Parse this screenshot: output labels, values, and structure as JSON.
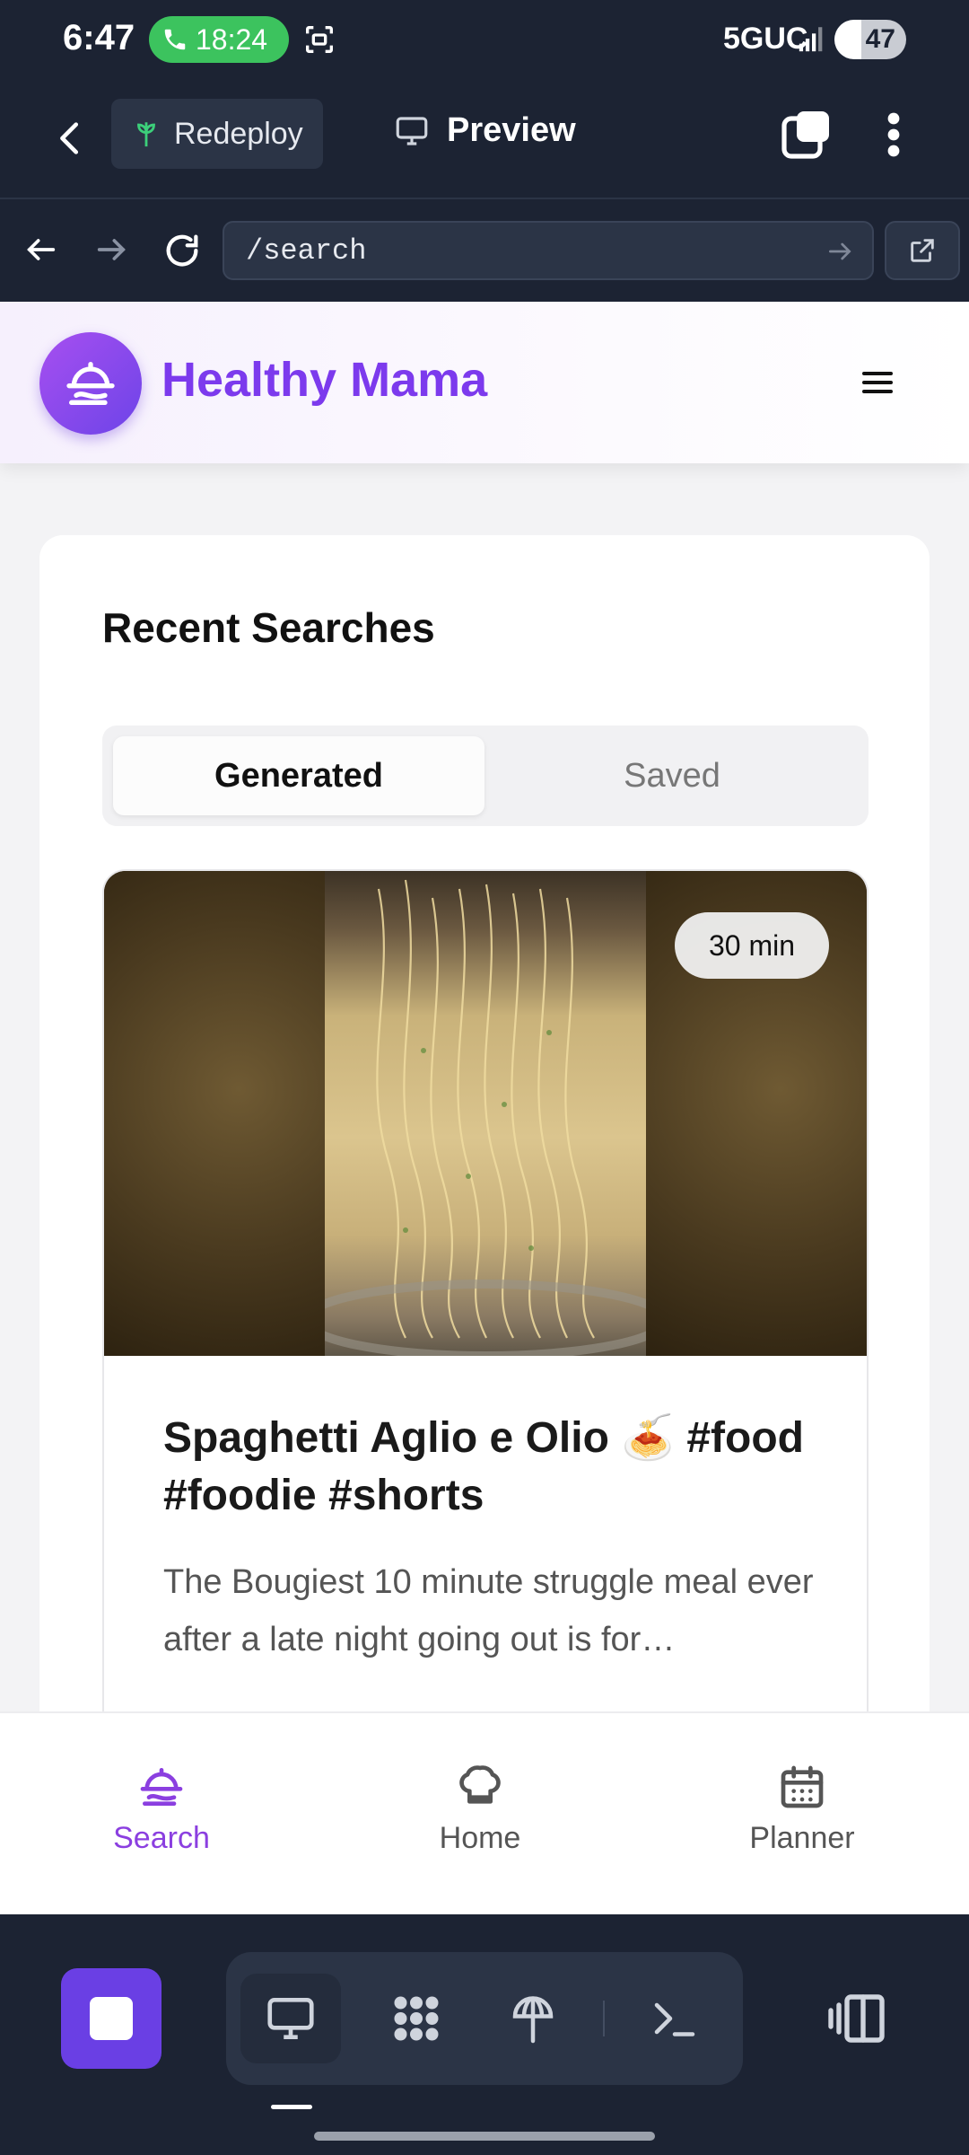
{
  "status_bar": {
    "time": "6:47",
    "call_duration": "18:24",
    "network": "5GUC",
    "battery": "47",
    "battery_level": 0.47
  },
  "toolbar": {
    "redeploy_label": "Redeploy",
    "preview_label": "Preview"
  },
  "url_bar": {
    "path": "/search"
  },
  "site": {
    "brand": "Healthy Mama",
    "brand_color": "#7c3aed",
    "section_title": "Recent Searches",
    "segments": [
      "Generated",
      "Saved"
    ],
    "selected_segment": "Generated",
    "recipe": {
      "time_badge": "30 min",
      "title": "Spaghetti Aglio e Olio 🍝 #food #foodie #shorts",
      "description": "The Bougiest 10 minute struggle meal ever after a late night going out is for…"
    }
  },
  "bottom_nav": {
    "items": [
      {
        "label": "Search",
        "icon": "cloche-icon",
        "active": true
      },
      {
        "label": "Home",
        "icon": "chef-hat-icon",
        "active": false
      },
      {
        "label": "Planner",
        "icon": "calendar-icon",
        "active": false
      }
    ],
    "active_color": "#8b3fe0"
  },
  "dock": {
    "accent_color": "#6a3fe4",
    "tools": [
      "desktop-icon",
      "apps-grid-icon",
      "deploy-icon",
      "terminal-icon"
    ]
  }
}
